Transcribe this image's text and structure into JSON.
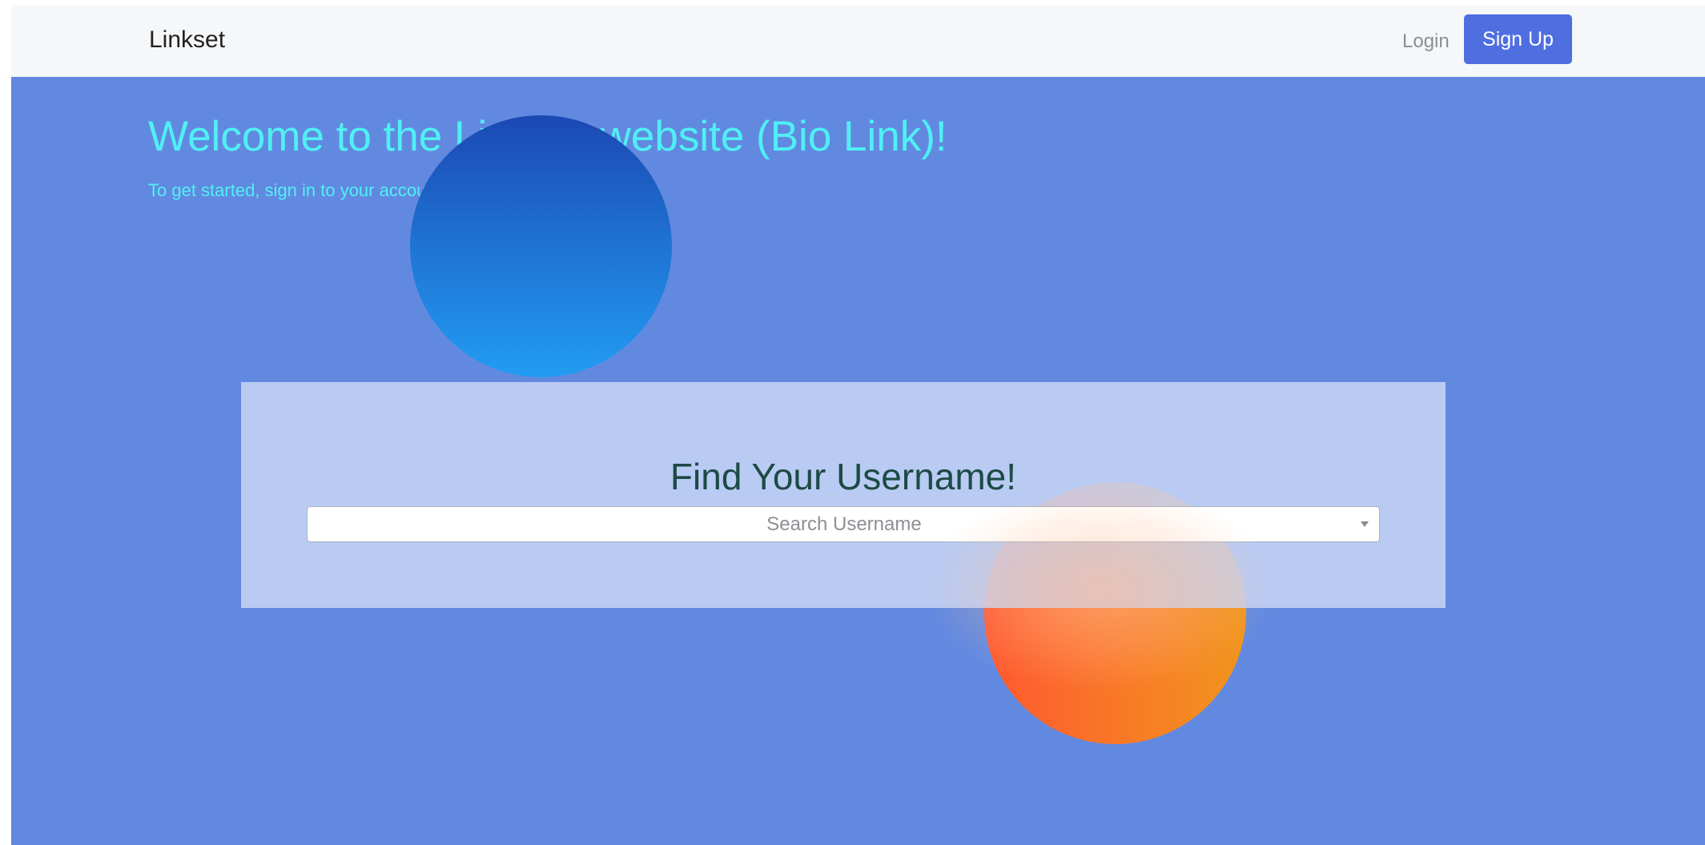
{
  "navbar": {
    "brand": "Linkset",
    "login_label": "Login",
    "signup_label": "Sign Up"
  },
  "hero": {
    "title": "Welcome to the Linkset website (Bio Link)!",
    "subtitle": "To get started, sign in to your account or create a new one."
  },
  "search": {
    "title": "Find Your Username!",
    "placeholder": "Search Username"
  },
  "colors": {
    "navbar_bg": "#f5f7f9",
    "hero_bg": "#6289e0",
    "accent_button": "#4f6fe0",
    "hero_text": "#4ff0f5",
    "search_title_text": "#1d4a45"
  },
  "icons": {
    "select_arrow": "chevron-down-icon"
  }
}
